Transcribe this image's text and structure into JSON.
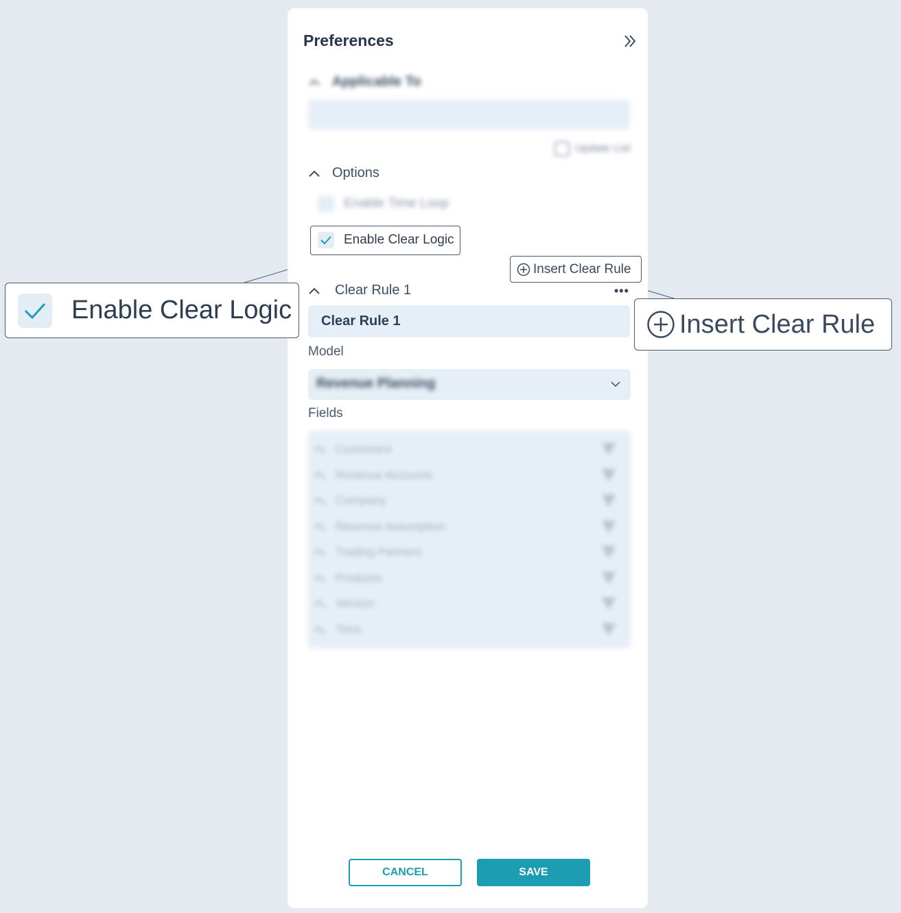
{
  "panel": {
    "title": "Preferences"
  },
  "applicable_to": {
    "label": "Applicable To",
    "update_list_label": "Update List"
  },
  "options": {
    "label": "Options",
    "enable_time_loop_label": "Enable Time Loop",
    "enable_clear_logic_label": "Enable Clear Logic",
    "enable_clear_logic_checked": true
  },
  "insert_rule": {
    "label": "Insert Clear Rule"
  },
  "clear_rule": {
    "header": "Clear Rule 1",
    "name_value": "Clear Rule 1",
    "model_label": "Model",
    "model_value": "Revenue Planning",
    "fields_label": "Fields",
    "fields": [
      "Customers",
      "Revenue Accounts",
      "Company",
      "Revenue Assumption",
      "Trading Partners",
      "Products",
      "Version",
      "Time"
    ]
  },
  "footer": {
    "cancel_label": "CANCEL",
    "save_label": "SAVE"
  },
  "callouts": {
    "enable_clear_logic": "Enable Clear Logic",
    "insert_clear_rule": "Insert Clear Rule"
  },
  "colors": {
    "accent": "#1c9db2",
    "background": "#e4eaf0",
    "input_bg": "#e6eef7"
  }
}
